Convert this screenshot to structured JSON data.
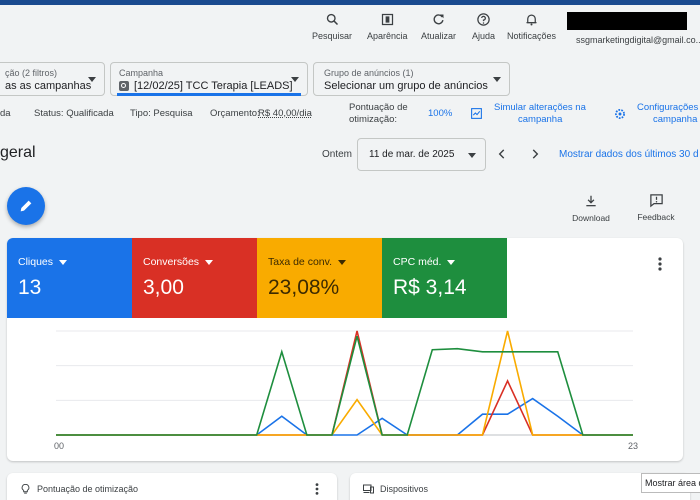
{
  "toolbar": {
    "search_label": "Pesquisar",
    "appearance_label": "Aparência",
    "refresh_label": "Atualizar",
    "help_label": "Ajuda",
    "notifications_label": "Notificações",
    "account_email": "ssgmarketingdigital@gmail.co..."
  },
  "filters": {
    "campaign_filter_label": "ção (2 filtros)",
    "campaign_filter_value": "as as campanhas",
    "campaign_label": "Campanha",
    "campaign_value": "[12/02/25] TCC Terapia [LEADS]",
    "adgroup_label": "Grupo de anúncios (1)",
    "adgroup_value": "Selecionar um grupo de anúncios"
  },
  "status_row": {
    "partial": "da",
    "status_label": "Status: Qualificada",
    "type_label": "Tipo: Pesquisa",
    "budget_label": "Orçamento:",
    "budget_value": "R$ 40,00/dia",
    "opt_score_label_1": "Pontuação de",
    "opt_score_label_2": "otimização:",
    "opt_score_value": "100%",
    "simulate_1": "Simular alterações na",
    "simulate_2": "campanha",
    "config_1": "Configurações",
    "config_2": "campanha"
  },
  "title_row": {
    "title": "geral",
    "period_label": "Ontem",
    "date_value": "11 de mar. de 2025",
    "show_last": "Mostrar dados dos últimos 30 d"
  },
  "actions": {
    "download_label": "Download",
    "feedback_label": "Feedback"
  },
  "metrics": [
    {
      "label": "Cliques",
      "value": "13",
      "color": "#1a73e8"
    },
    {
      "label": "Conversões",
      "value": "3,00",
      "color": "#d93025"
    },
    {
      "label": "Taxa de conv.",
      "value": "23,08%",
      "color": "#f9ab00"
    },
    {
      "label": "CPC méd.",
      "value": "R$ 3,14",
      "color": "#1e8e3e"
    }
  ],
  "chart_data": {
    "type": "line",
    "x": [
      0,
      1,
      2,
      3,
      4,
      5,
      6,
      7,
      8,
      9,
      10,
      11,
      12,
      13,
      14,
      15,
      16,
      17,
      18,
      19,
      20,
      21,
      22,
      23
    ],
    "x_tick_labels": [
      "00",
      "23"
    ],
    "grid": true,
    "series": [
      {
        "color": "#1a73e8",
        "values": [
          0,
          0,
          0,
          0,
          0,
          0,
          0,
          0,
          0,
          0.18,
          0,
          0,
          0,
          0.16,
          0,
          0,
          0,
          0.2,
          0.2,
          0.35,
          0.18,
          0,
          0,
          0
        ]
      },
      {
        "color": "#d93025",
        "values": [
          0,
          0,
          0,
          0,
          0,
          0,
          0,
          0,
          0,
          0,
          0,
          0,
          1.0,
          0,
          0,
          0,
          0,
          0,
          0.52,
          0,
          0,
          0,
          0,
          0
        ]
      },
      {
        "color": "#f9ab00",
        "values": [
          0,
          0,
          0,
          0,
          0,
          0,
          0,
          0,
          0,
          0,
          0,
          0,
          0.34,
          0,
          0,
          0,
          0,
          0,
          1.0,
          0,
          0,
          0,
          0,
          0
        ]
      },
      {
        "color": "#1e8e3e",
        "values": [
          0,
          0,
          0,
          0,
          0,
          0,
          0,
          0,
          0,
          0.8,
          0,
          0,
          0.95,
          0,
          0,
          0.82,
          0.83,
          0.8,
          0.8,
          0.8,
          0.8,
          0,
          0,
          0
        ]
      }
    ]
  },
  "bottom": {
    "opt_card_label": "Pontuação de otimização",
    "devices_label": "Dispositivos",
    "tooltip": "Mostrar área de"
  }
}
